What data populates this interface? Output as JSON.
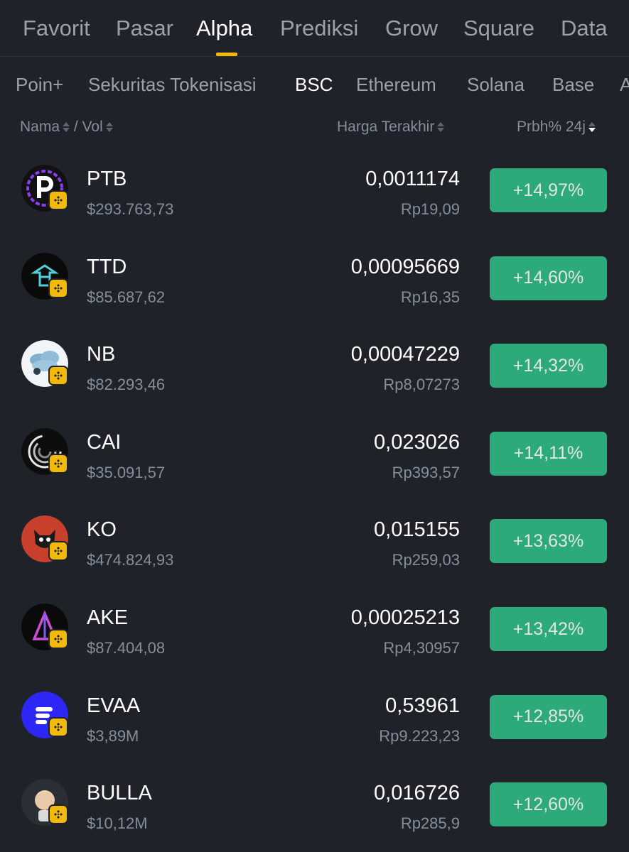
{
  "top_tabs": [
    "Favorit",
    "Pasar",
    "Alpha",
    "Prediksi",
    "Grow",
    "Square",
    "Data"
  ],
  "active_top_tab": "Alpha",
  "sub_tabs": [
    "Poin+",
    "Sekuritas Tokenisasi",
    "BSC",
    "Ethereum",
    "Solana",
    "Base",
    "A"
  ],
  "active_sub_tab": "BSC",
  "columns": {
    "name": "Nama",
    "separator": " / ",
    "vol": "Vol",
    "price": "Harga Terakhir",
    "change": "Prbh% 24j"
  },
  "tokens": [
    {
      "symbol": "PTB",
      "volume": "$293.763,73",
      "price": "0,0011174",
      "price_idr": "Rp19,09",
      "change": "+14,97%",
      "icon": "ptb-logo-icon"
    },
    {
      "symbol": "TTD",
      "volume": "$85.687,62",
      "price": "0,00095669",
      "price_idr": "Rp16,35",
      "change": "+14,60%",
      "icon": "ttd-logo-icon"
    },
    {
      "symbol": "NB",
      "volume": "$82.293,46",
      "price": "0,00047229",
      "price_idr": "Rp8,07273",
      "change": "+14,32%",
      "icon": "nb-logo-icon"
    },
    {
      "symbol": "CAI",
      "volume": "$35.091,57",
      "price": "0,023026",
      "price_idr": "Rp393,57",
      "change": "+14,11%",
      "icon": "cai-logo-icon"
    },
    {
      "symbol": "KO",
      "volume": "$474.824,93",
      "price": "0,015155",
      "price_idr": "Rp259,03",
      "change": "+13,63%",
      "icon": "ko-logo-icon"
    },
    {
      "symbol": "AKE",
      "volume": "$87.404,08",
      "price": "0,00025213",
      "price_idr": "Rp4,30957",
      "change": "+13,42%",
      "icon": "ake-logo-icon"
    },
    {
      "symbol": "EVAA",
      "volume": "$3,89M",
      "price": "0,53961",
      "price_idr": "Rp9.223,23",
      "change": "+12,85%",
      "icon": "evaa-logo-icon"
    },
    {
      "symbol": "BULLA",
      "volume": "$10,12M",
      "price": "0,016726",
      "price_idr": "Rp285,9",
      "change": "+12,60%",
      "icon": "bulla-logo-icon"
    }
  ],
  "colors": {
    "background": "#1f2329",
    "accent": "#f0b90b",
    "positive": "#2ebd85",
    "muted_text": "#848e9c"
  }
}
